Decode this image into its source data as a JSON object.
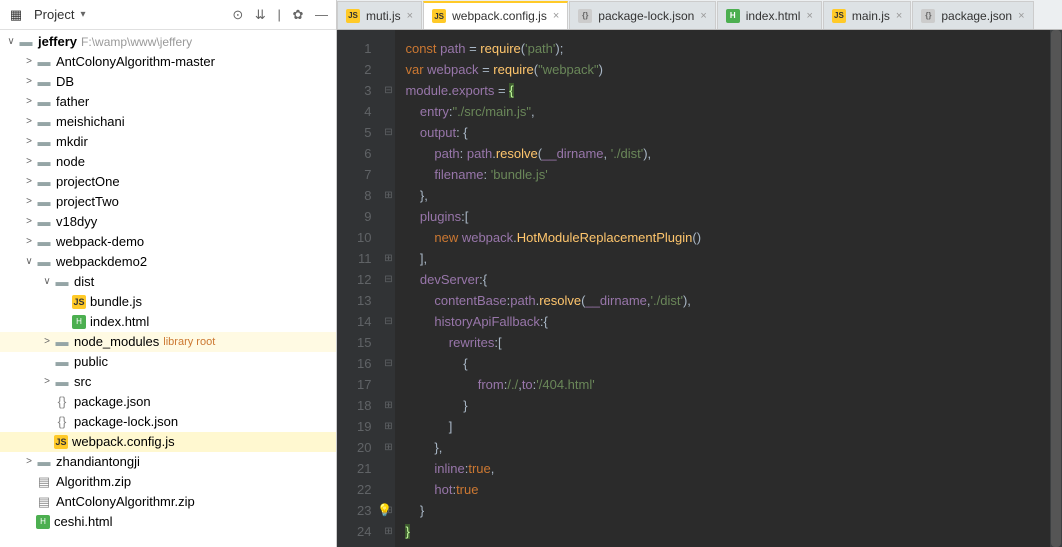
{
  "project_panel": {
    "title": "Project",
    "root": {
      "name": "jeffery",
      "path": "F:\\wamp\\www\\jeffery"
    },
    "tree": [
      {
        "d": 1,
        "exp": "right",
        "k": "folder",
        "label": "AntColonyAlgorithm-master"
      },
      {
        "d": 1,
        "exp": "right",
        "k": "folder",
        "label": "DB"
      },
      {
        "d": 1,
        "exp": "right",
        "k": "folder",
        "label": "father"
      },
      {
        "d": 1,
        "exp": "right",
        "k": "folder",
        "label": "meishichani"
      },
      {
        "d": 1,
        "exp": "right",
        "k": "folder",
        "label": "mkdir"
      },
      {
        "d": 1,
        "exp": "right",
        "k": "folder",
        "label": "node"
      },
      {
        "d": 1,
        "exp": "right",
        "k": "folder",
        "label": "projectOne"
      },
      {
        "d": 1,
        "exp": "right",
        "k": "folder",
        "label": "projectTwo"
      },
      {
        "d": 1,
        "exp": "right",
        "k": "folder",
        "label": "v18dyy"
      },
      {
        "d": 1,
        "exp": "right",
        "k": "folder",
        "label": "webpack-demo"
      },
      {
        "d": 1,
        "exp": "down",
        "k": "folder",
        "label": "webpackdemo2"
      },
      {
        "d": 2,
        "exp": "down",
        "k": "folder",
        "label": "dist"
      },
      {
        "d": 3,
        "exp": "none",
        "k": "js",
        "label": "bundle.js"
      },
      {
        "d": 3,
        "exp": "none",
        "k": "html",
        "label": "index.html"
      },
      {
        "d": 2,
        "exp": "right",
        "k": "folder",
        "label": "node_modules",
        "extra": "library root",
        "hi": true
      },
      {
        "d": 2,
        "exp": "none",
        "k": "folder",
        "label": "public"
      },
      {
        "d": 2,
        "exp": "right",
        "k": "folder",
        "label": "src"
      },
      {
        "d": 2,
        "exp": "none",
        "k": "json",
        "label": "package.json"
      },
      {
        "d": 2,
        "exp": "none",
        "k": "json",
        "label": "package-lock.json"
      },
      {
        "d": 2,
        "exp": "none",
        "k": "js",
        "label": "webpack.config.js",
        "sel": true
      },
      {
        "d": 1,
        "exp": "right",
        "k": "folder",
        "label": "zhandiantongji"
      },
      {
        "d": 1,
        "exp": "none",
        "k": "zip",
        "label": "Algorithm.zip"
      },
      {
        "d": 1,
        "exp": "none",
        "k": "zip",
        "label": "AntColonyAlgorithmr.zip"
      },
      {
        "d": 1,
        "exp": "none",
        "k": "html",
        "label": "ceshi.html"
      }
    ]
  },
  "tabs": [
    {
      "icon": "js",
      "label": "muti.js",
      "active": false
    },
    {
      "icon": "js",
      "label": "webpack.config.js",
      "active": true
    },
    {
      "icon": "json",
      "label": "package-lock.json",
      "active": false
    },
    {
      "icon": "html",
      "label": "index.html",
      "active": false
    },
    {
      "icon": "js",
      "label": "main.js",
      "active": false
    },
    {
      "icon": "json",
      "label": "package.json",
      "active": false
    }
  ],
  "code": {
    "lines": [
      [
        [
          "kw",
          "const "
        ],
        [
          "id",
          "path"
        ],
        [
          "op",
          " = "
        ],
        [
          "fn",
          "require"
        ],
        [
          "punc",
          "("
        ],
        [
          "str",
          "'path'"
        ],
        [
          "punc",
          ");"
        ]
      ],
      [
        [
          "kw",
          "var "
        ],
        [
          "id",
          "webpack"
        ],
        [
          "op",
          " = "
        ],
        [
          "fn",
          "require"
        ],
        [
          "punc",
          "("
        ],
        [
          "str",
          "\"webpack\""
        ],
        [
          "punc",
          ")"
        ]
      ],
      [
        [
          "id",
          "module"
        ],
        [
          "punc",
          "."
        ],
        [
          "id",
          "exports"
        ],
        [
          "op",
          " = "
        ],
        [
          "brace-hl",
          "{"
        ]
      ],
      [
        [
          "id",
          "    entry"
        ],
        [
          "punc",
          ":"
        ],
        [
          "str",
          "\"./src/main.js\""
        ],
        [
          "punc",
          ","
        ]
      ],
      [
        [
          "id",
          "    output"
        ],
        [
          "punc",
          ": {"
        ]
      ],
      [
        [
          "id",
          "        path"
        ],
        [
          "punc",
          ": "
        ],
        [
          "id",
          "path"
        ],
        [
          "punc",
          "."
        ],
        [
          "fn",
          "resolve"
        ],
        [
          "punc",
          "("
        ],
        [
          "id",
          "__dirname"
        ],
        [
          "punc",
          ", "
        ],
        [
          "str",
          "'./dist'"
        ],
        [
          "punc",
          "),"
        ]
      ],
      [
        [
          "id",
          "        filename"
        ],
        [
          "punc",
          ": "
        ],
        [
          "str",
          "'bundle.js'"
        ]
      ],
      [
        [
          "punc",
          "    },"
        ]
      ],
      [
        [
          "id",
          "    plugins"
        ],
        [
          "punc",
          ":["
        ]
      ],
      [
        [
          "kw",
          "        new "
        ],
        [
          "id",
          "webpack"
        ],
        [
          "punc",
          "."
        ],
        [
          "fn",
          "HotModuleReplacementPlugin"
        ],
        [
          "punc",
          "()"
        ]
      ],
      [
        [
          "punc",
          "    ],"
        ]
      ],
      [
        [
          "id",
          "    devServer"
        ],
        [
          "punc",
          ":{"
        ]
      ],
      [
        [
          "id",
          "        contentBase"
        ],
        [
          "punc",
          ":"
        ],
        [
          "id",
          "path"
        ],
        [
          "punc",
          "."
        ],
        [
          "fn",
          "resolve"
        ],
        [
          "punc",
          "("
        ],
        [
          "id",
          "__dirname"
        ],
        [
          "punc",
          ","
        ],
        [
          "str",
          "'./dist'"
        ],
        [
          "punc",
          "),"
        ]
      ],
      [
        [
          "id",
          "        historyApiFallback"
        ],
        [
          "punc",
          ":{"
        ]
      ],
      [
        [
          "id",
          "            rewrites"
        ],
        [
          "punc",
          ":["
        ]
      ],
      [
        [
          "punc",
          "                {"
        ]
      ],
      [
        [
          "id",
          "                    from"
        ],
        [
          "punc",
          ":"
        ],
        [
          "str",
          "/./"
        ],
        [
          "punc",
          ","
        ],
        [
          "id",
          "to"
        ],
        [
          "punc",
          ":"
        ],
        [
          "str",
          "'/404.html'"
        ]
      ],
      [
        [
          "punc",
          "                }"
        ]
      ],
      [
        [
          "punc",
          "            ]"
        ]
      ],
      [
        [
          "punc",
          "        },"
        ]
      ],
      [
        [
          "id",
          "        inline"
        ],
        [
          "punc",
          ":"
        ],
        [
          "kw",
          "true"
        ],
        [
          "punc",
          ","
        ]
      ],
      [
        [
          "id",
          "        hot"
        ],
        [
          "punc",
          ":"
        ],
        [
          "kw",
          "true"
        ]
      ],
      [
        [
          "punc",
          "    }"
        ]
      ],
      [
        [
          "brace-hl",
          "}"
        ]
      ]
    ],
    "fold": [
      "",
      "",
      "⊟",
      "",
      "⊟",
      "",
      "",
      "⊞",
      "",
      "",
      "⊞",
      "⊟",
      "",
      "⊟",
      "",
      "⊟",
      "",
      "⊞",
      "⊞",
      "⊞",
      "",
      "",
      "⊞",
      "⊞"
    ]
  }
}
